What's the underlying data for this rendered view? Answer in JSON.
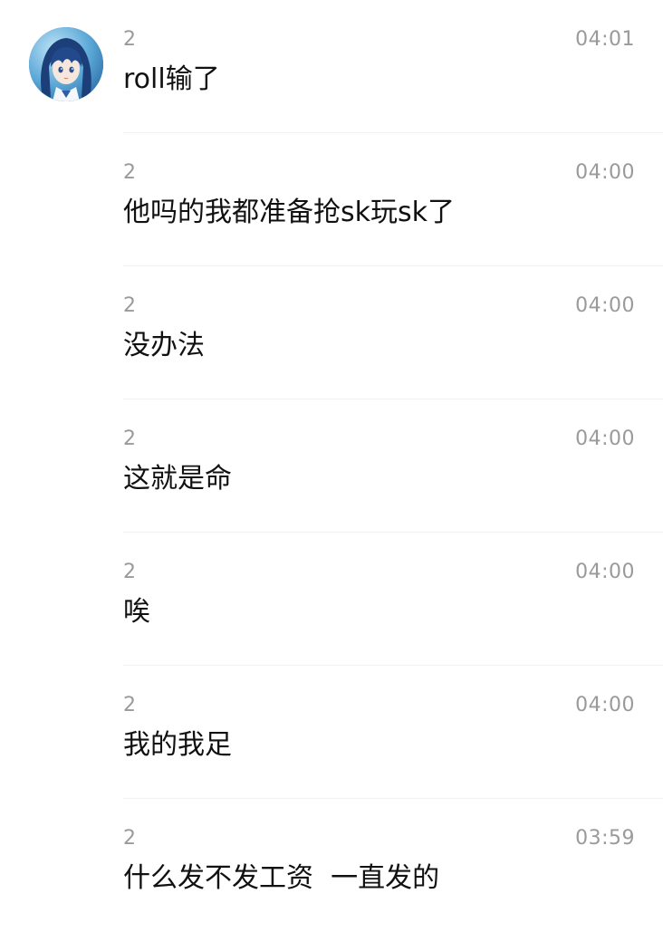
{
  "messages": [
    {
      "sender": "2",
      "time": "04:01",
      "text": "roll输了"
    },
    {
      "sender": "2",
      "time": "04:00",
      "text": "他吗的我都准备抢sk玩sk了"
    },
    {
      "sender": "2",
      "time": "04:00",
      "text": "没办法"
    },
    {
      "sender": "2",
      "time": "04:00",
      "text": "这就是命"
    },
    {
      "sender": "2",
      "time": "04:00",
      "text": "唉"
    },
    {
      "sender": "2",
      "time": "04:00",
      "text": "我的我足"
    },
    {
      "sender": "2",
      "time": "03:59",
      "text": "什么发不发工资  一直发的"
    }
  ],
  "colors": {
    "meta_text": "#9a9a9a",
    "message_text": "#111111",
    "divider": "#f1f1f1"
  }
}
